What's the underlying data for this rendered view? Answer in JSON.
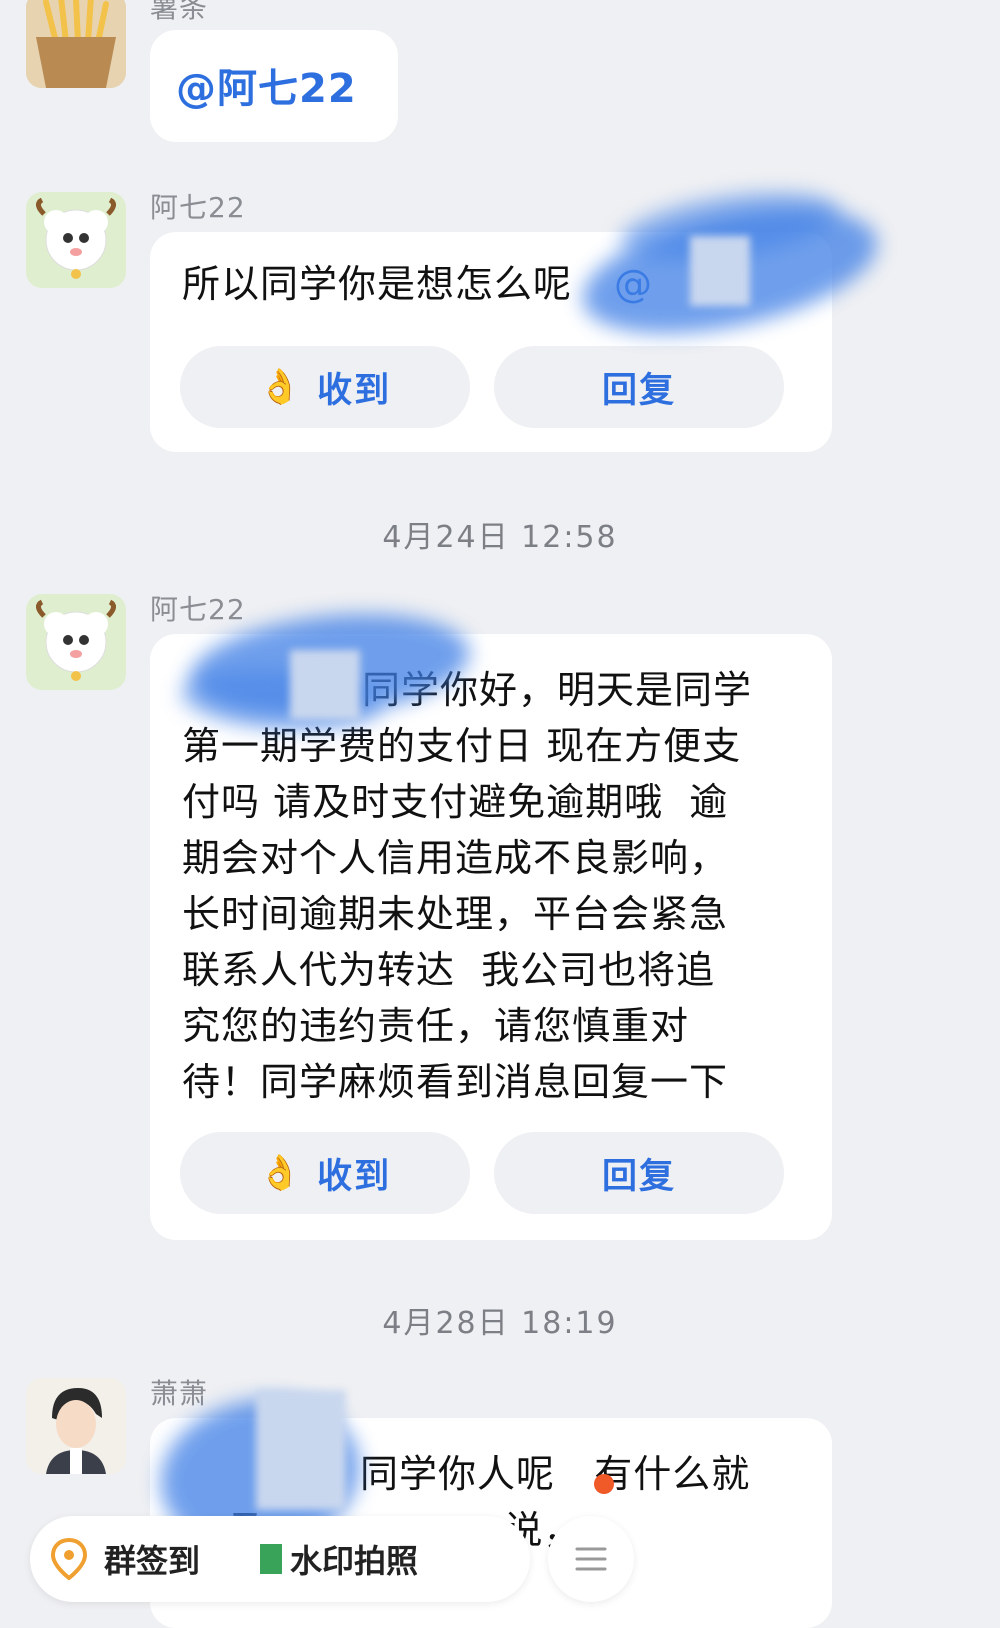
{
  "messages": [
    {
      "sender": "薯条",
      "avatar_icon": "fries-icon",
      "text": "@阿七22"
    },
    {
      "sender": "阿七22",
      "avatar_icon": "sheep-icon",
      "text": "所以同学你是想怎么呢",
      "mention_partial": "@",
      "actions": {
        "ack_label": "收到",
        "reply_label": "回复",
        "ack_icon": "ok-hand-icon"
      }
    },
    {
      "timestamp": "4月24日 12:58",
      "sender": "阿七22",
      "avatar_icon": "sheep-icon",
      "text_lines": [
        "同学你好，明天是同学",
        "第一期学费的支付日 现在方便支",
        "付吗 请及时支付避免逾期哦  逾",
        "期会对个人信用造成不良影响，",
        "长时间逾期未处理，平台会紧急",
        "联系人代为转达  我公司也将追",
        "究您的违约责任，请您慎重对",
        "待！同学麻烦看到消息回复一下"
      ],
      "actions": {
        "ack_label": "收到",
        "reply_label": "回复",
        "ack_icon": "ok-hand-icon"
      }
    },
    {
      "timestamp": "4月28日 18:19",
      "sender": "萧萧",
      "avatar_icon": "person-avatar-icon",
      "text_lines": [
        "同学你人呢   有什么就",
        "及                  说，"
      ]
    }
  ],
  "bottom_bar": {
    "checkin_label": "群签到",
    "checkin_icon": "location-pin-icon",
    "watermark_label": "水印拍照",
    "menu_icon": "menu-icon"
  },
  "colors": {
    "accent": "#2e6fe0",
    "background": "#eff0f3",
    "bubble": "#ffffff",
    "notice_dot": "#f05a28"
  }
}
